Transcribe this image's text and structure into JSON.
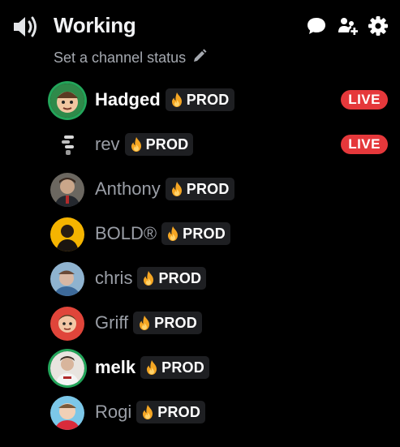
{
  "channel": {
    "name": "Working",
    "status_placeholder": "Set a channel status",
    "header_icons": [
      "speaker-icon",
      "chat-bubble-icon",
      "add-member-icon",
      "gear-icon"
    ]
  },
  "tag_icon": "flame-icon",
  "live_label": "LIVE",
  "colors": {
    "background": "#000000",
    "live_badge": "#e5383b",
    "speaking_ring": "#23a55a",
    "tag_flame": "#f5a623",
    "muted_text": "#9a9ea6"
  },
  "members": [
    {
      "name": "Hadged",
      "tag": "PROD",
      "live": true,
      "active": true,
      "speaking": true
    },
    {
      "name": "rev",
      "tag": "PROD",
      "live": true,
      "active": false,
      "speaking": false
    },
    {
      "name": "Anthony",
      "tag": "PROD",
      "live": false,
      "active": false,
      "speaking": false
    },
    {
      "name": "BOLD®",
      "tag": "PROD",
      "live": false,
      "active": false,
      "speaking": false
    },
    {
      "name": "chris",
      "tag": "PROD",
      "live": false,
      "active": false,
      "speaking": false
    },
    {
      "name": "Griff",
      "tag": "PROD",
      "live": false,
      "active": false,
      "speaking": false
    },
    {
      "name": "melk",
      "tag": "PROD",
      "live": false,
      "active": true,
      "speaking": true
    },
    {
      "name": "Rogi",
      "tag": "PROD",
      "live": false,
      "active": false,
      "speaking": false
    }
  ]
}
